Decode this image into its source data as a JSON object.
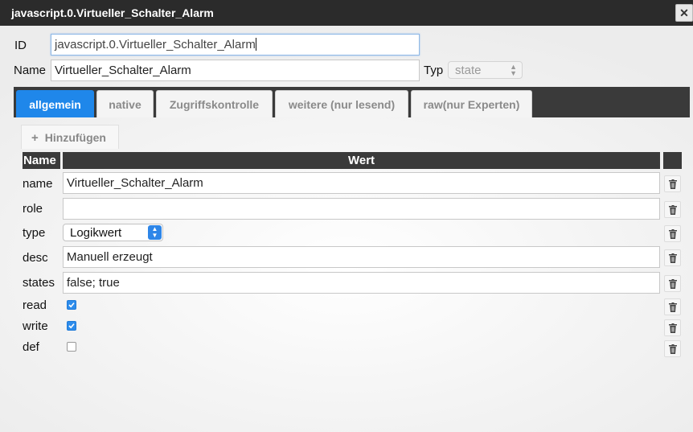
{
  "window": {
    "title": "javascript.0.Virtueller_Schalter_Alarm",
    "close_label": "✕"
  },
  "form": {
    "id_label": "ID",
    "id_value": "javascript.0.Virtueller_Schalter_Alarm",
    "name_label": "Name",
    "name_value": "Virtueller_Schalter_Alarm",
    "typ_label": "Typ",
    "typ_value": "state"
  },
  "tabs": [
    {
      "label": "allgemein",
      "active": true
    },
    {
      "label": "native",
      "active": false
    },
    {
      "label": "Zugriffskontrolle",
      "active": false
    },
    {
      "label": "weitere (nur lesend)",
      "active": false
    },
    {
      "label": "raw(nur Experten)",
      "active": false
    }
  ],
  "add_button": {
    "icon": "plus-icon",
    "label": "Hinzufügen"
  },
  "table": {
    "headers": [
      "Name",
      "Wert"
    ],
    "rows": [
      {
        "name": "name",
        "value": "Virtueller_Schalter_Alarm",
        "kind": "text"
      },
      {
        "name": "role",
        "value": "",
        "kind": "text"
      },
      {
        "name": "type",
        "value": "Logikwert",
        "kind": "select"
      },
      {
        "name": "desc",
        "value": "Manuell erzeugt",
        "kind": "text"
      },
      {
        "name": "states",
        "value": "false; true",
        "kind": "text"
      },
      {
        "name": "read",
        "checked": true,
        "kind": "checkbox"
      },
      {
        "name": "write",
        "checked": true,
        "kind": "checkbox"
      },
      {
        "name": "def",
        "checked": false,
        "kind": "checkbox"
      }
    ],
    "delete_icon": "trash-icon"
  },
  "colors": {
    "accent": "#1f87ea",
    "header_bg": "#3a3a3a",
    "titlebar_bg": "#2b2b2b"
  }
}
